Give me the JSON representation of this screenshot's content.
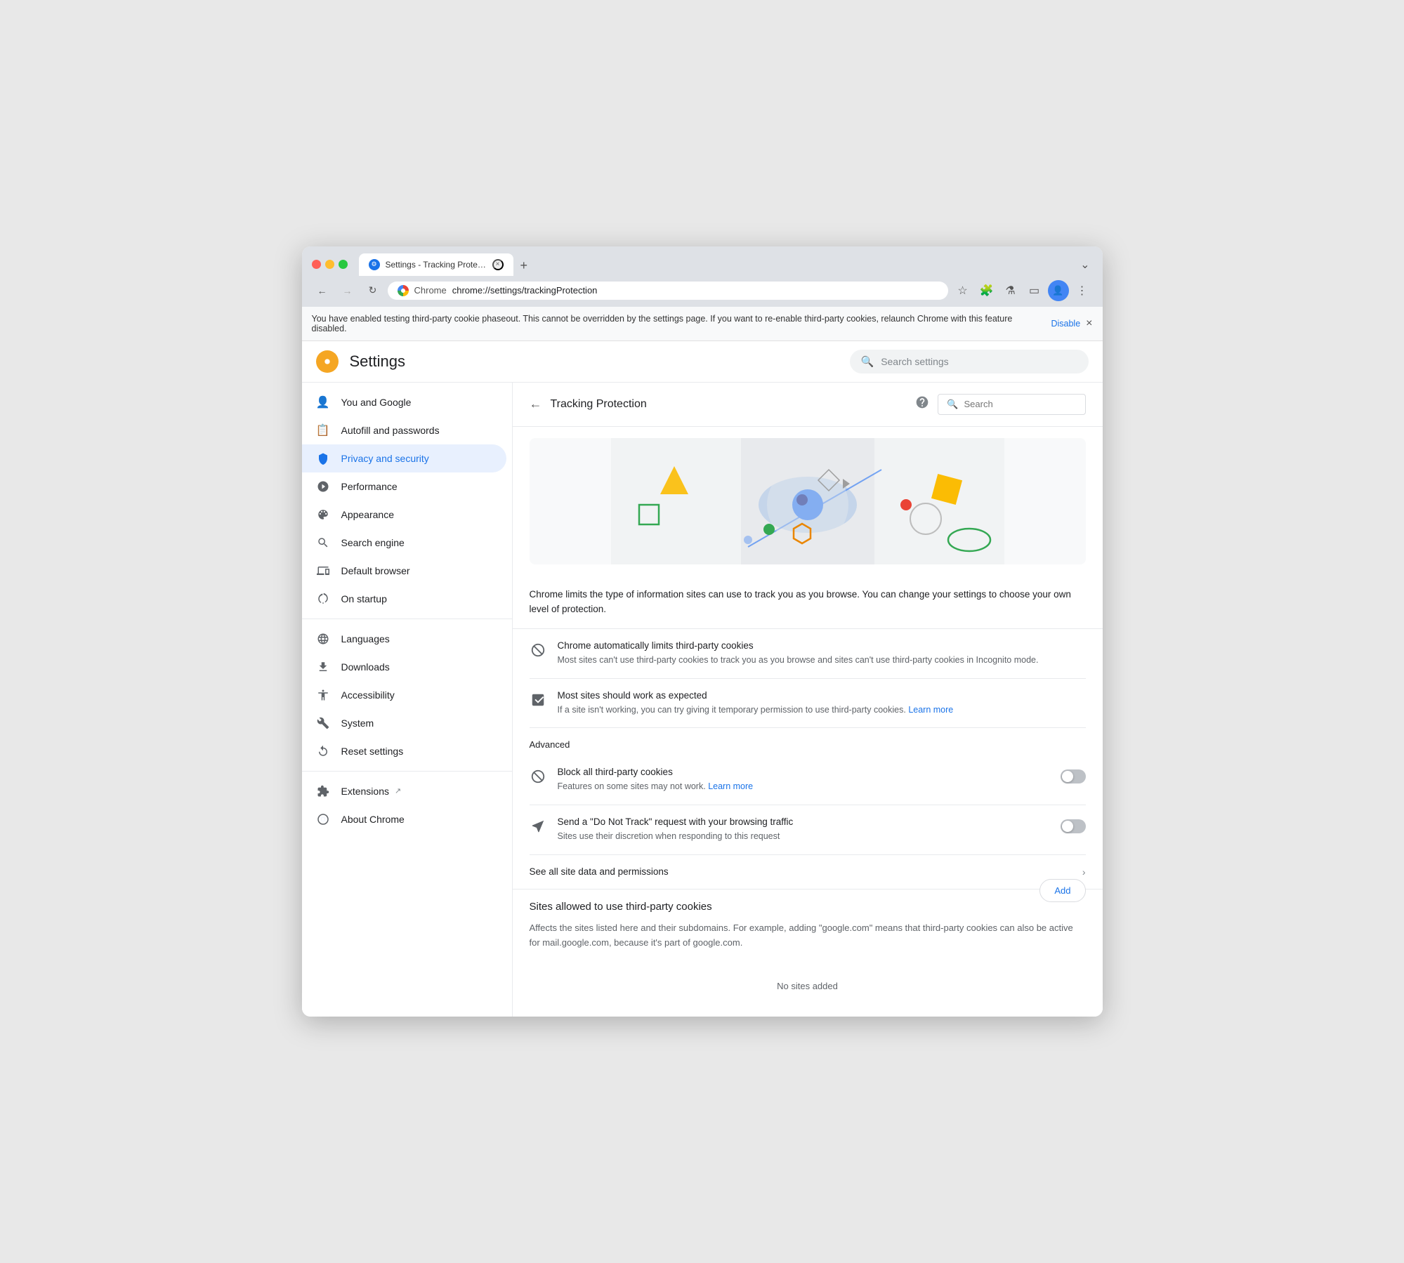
{
  "window": {
    "title": "Settings - Tracking Protection",
    "tab_close": "×",
    "new_tab": "+"
  },
  "titlebar": {
    "tab_title": "Settings - Tracking Protectio…",
    "tab_favicon": "⚙"
  },
  "navbar": {
    "back": "←",
    "forward": "→",
    "reload": "↻",
    "chrome_label": "Chrome",
    "address": "chrome://settings/trackingProtection",
    "bookmark": "☆",
    "extensions": "🧩",
    "labs": "⚗",
    "browser": "▭",
    "profile": "👤",
    "menu": "⋮"
  },
  "infobar": {
    "text": "You have enabled testing third-party cookie phaseout. This cannot be overridden by the settings page. If you want to re-enable third-party cookies, relaunch Chrome with this feature disabled.",
    "link_text": "Disable",
    "close": "×"
  },
  "settings": {
    "logo": "G",
    "title": "Settings",
    "search_placeholder": "Search settings"
  },
  "sidebar": {
    "items": [
      {
        "id": "you-and-google",
        "label": "You and Google",
        "icon": "👤"
      },
      {
        "id": "autofill",
        "label": "Autofill and passwords",
        "icon": "📋"
      },
      {
        "id": "privacy",
        "label": "Privacy and security",
        "icon": "🛡",
        "active": true
      },
      {
        "id": "performance",
        "label": "Performance",
        "icon": "⚡"
      },
      {
        "id": "appearance",
        "label": "Appearance",
        "icon": "🎨"
      },
      {
        "id": "search-engine",
        "label": "Search engine",
        "icon": "🔍"
      },
      {
        "id": "default-browser",
        "label": "Default browser",
        "icon": "🗔"
      },
      {
        "id": "on-startup",
        "label": "On startup",
        "icon": "⏻"
      }
    ],
    "items2": [
      {
        "id": "languages",
        "label": "Languages",
        "icon": "🌐"
      },
      {
        "id": "downloads",
        "label": "Downloads",
        "icon": "⬇"
      },
      {
        "id": "accessibility",
        "label": "Accessibility",
        "icon": "♿"
      },
      {
        "id": "system",
        "label": "System",
        "icon": "🔧"
      },
      {
        "id": "reset-settings",
        "label": "Reset settings",
        "icon": "↺"
      }
    ],
    "items3": [
      {
        "id": "extensions",
        "label": "Extensions",
        "icon": "🧩",
        "external": true
      },
      {
        "id": "about-chrome",
        "label": "About Chrome",
        "icon": "ℹ"
      }
    ]
  },
  "tracking": {
    "title": "Tracking Protection",
    "help": "?",
    "search_placeholder": "Search",
    "description": "Chrome limits the type of information sites can use to track you as you browse. You can change your settings to choose your own level of protection.",
    "option1_title": "Chrome automatically limits third-party cookies",
    "option1_desc": "Most sites can't use third-party cookies to track you as you browse and sites can't use third-party cookies in Incognito mode.",
    "option2_title": "Most sites should work as expected",
    "option2_desc": "If a site isn't working, you can try giving it temporary permission to use third-party cookies.",
    "option2_link": "Learn more",
    "advanced_label": "Advanced",
    "toggle1_title": "Block all third-party cookies",
    "toggle1_desc": "Features on some sites may not work.",
    "toggle1_link": "Learn more",
    "toggle2_title": "Send a \"Do Not Track\" request with your browsing traffic",
    "toggle2_desc": "Sites use their discretion when responding to this request",
    "site_data_label": "See all site data and permissions",
    "sites_allowed_title": "Sites allowed to use third-party cookies",
    "sites_allowed_desc": "Affects the sites listed here and their subdomains. For example, adding \"google.com\" means that third-party cookies can also be active for mail.google.com, because it's part of google.com.",
    "add_btn": "Add",
    "no_sites": "No sites added"
  }
}
